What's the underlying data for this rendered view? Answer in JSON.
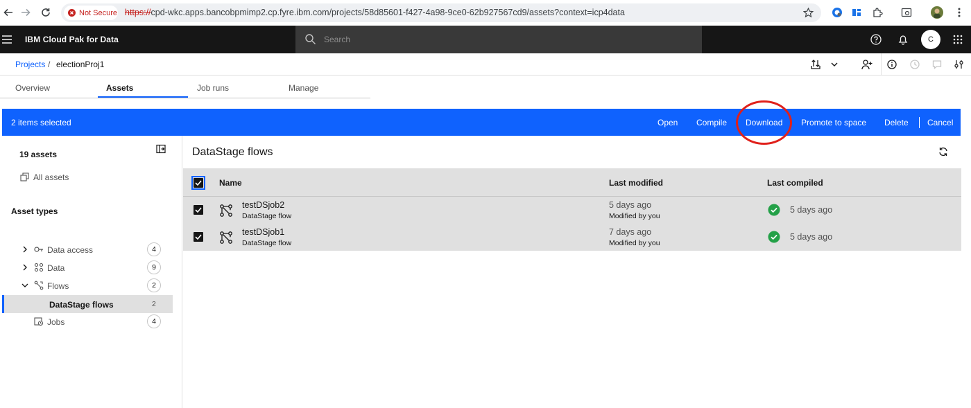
{
  "browser": {
    "security_label": "Not Secure",
    "url_scheme": "https://",
    "url_rest": "cpd-wkc.apps.bancobpmimp2.cp.fyre.ibm.com/projects/58d85601-f427-4a98-9ce0-62b927567cd9/assets?context=icp4data"
  },
  "header": {
    "brand": "IBM Cloud Pak for Data",
    "search_placeholder": "Search",
    "avatar_initial": "C"
  },
  "breadcrumb": {
    "root": "Projects",
    "separator": "/",
    "current": "electionProj1"
  },
  "tabs": [
    {
      "label": "Overview"
    },
    {
      "label": "Assets"
    },
    {
      "label": "Job runs"
    },
    {
      "label": "Manage"
    }
  ],
  "selection": {
    "count_label": "2 items selected",
    "actions": {
      "open": "Open",
      "compile": "Compile",
      "download": "Download",
      "promote": "Promote to space",
      "delete": "Delete",
      "cancel": "Cancel"
    }
  },
  "sidebar": {
    "assets_count": "19 assets",
    "all_assets": "All assets",
    "asset_types_heading": "Asset types",
    "items": [
      {
        "label": "Data access",
        "count": "4"
      },
      {
        "label": "Data",
        "count": "9"
      },
      {
        "label": "Flows",
        "count": "2"
      },
      {
        "label": "DataStage flows",
        "count": "2"
      },
      {
        "label": "Jobs",
        "count": "4"
      }
    ]
  },
  "main": {
    "title": "DataStage flows",
    "columns": {
      "name": "Name",
      "last_modified": "Last modified",
      "last_compiled": "Last compiled"
    },
    "rows": [
      {
        "name": "testDSjob2",
        "type": "DataStage flow",
        "modified": "5 days ago",
        "modified_by": "Modified by you",
        "compiled": "5 days ago"
      },
      {
        "name": "testDSjob1",
        "type": "DataStage flow",
        "modified": "7 days ago",
        "modified_by": "Modified by you",
        "compiled": "5 days ago"
      }
    ]
  },
  "colors": {
    "accent": "#0f62fe",
    "header_bg": "#161616",
    "success": "#24a148",
    "annotation": "#e0201b"
  }
}
